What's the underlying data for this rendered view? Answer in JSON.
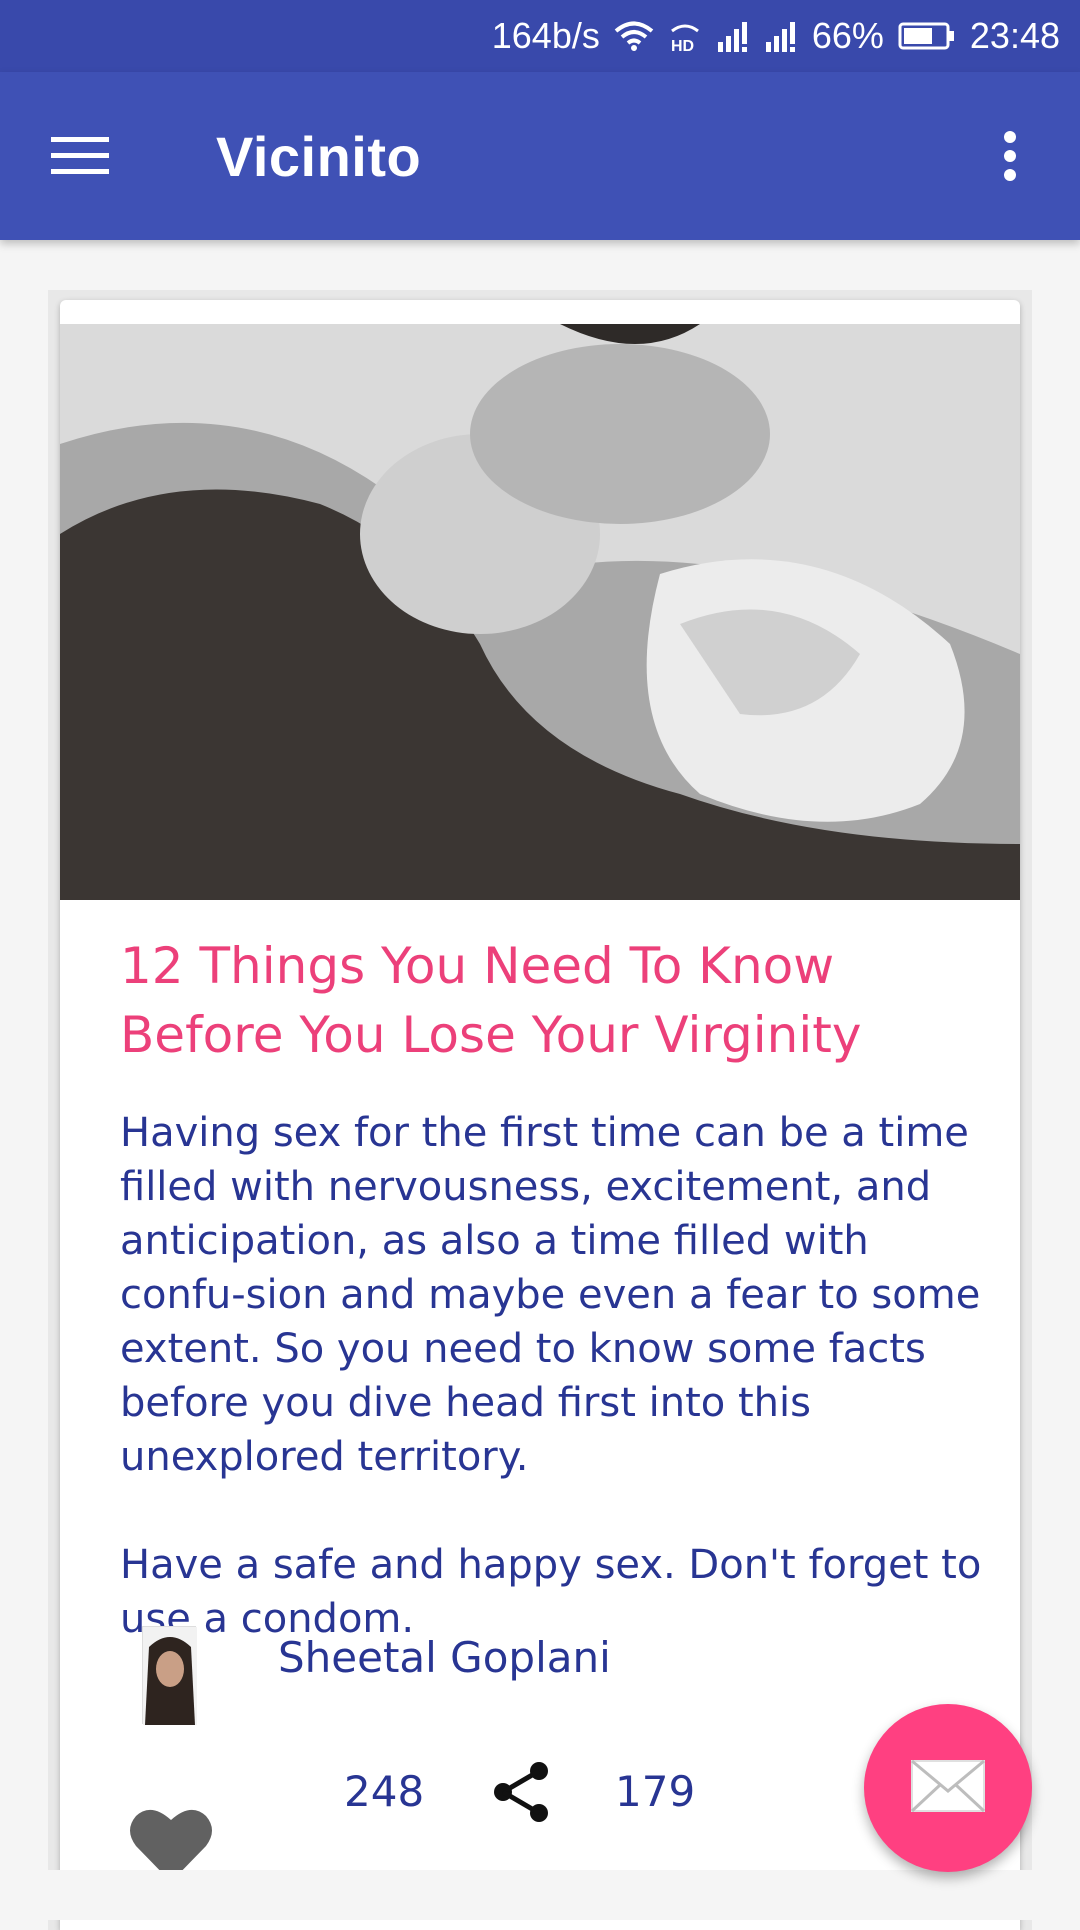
{
  "status_bar": {
    "network_speed": "164b/s",
    "battery_percent": "66%",
    "time": "23:48",
    "icons": [
      "wifi-icon",
      "hd-icon",
      "signal-icon",
      "signal-icon",
      "battery-icon"
    ]
  },
  "app_bar": {
    "title": "Vicinito",
    "menu_icon": "hamburger-menu-icon",
    "overflow_icon": "more-vert-icon"
  },
  "post": {
    "title": "12 Things You Need To Know Before You Lose Your Virginity",
    "body_paragraphs": [
      "Having sex for the first time can be a time filled with nervousness, excitement, and anticipation, as also a time filled with confu-sion and maybe even a fear to some extent. So you need to know some facts before you dive head first into this unexplored territory.",
      "Have a safe and happy sex. Don't forget to use a condom."
    ],
    "author": "Sheetal Goplani",
    "likes": "248",
    "shares": "179"
  },
  "colors": {
    "primary": "#3f51b5",
    "primary_dark": "#3949ab",
    "accent": "#ff4081",
    "title_pink": "#ec407a",
    "body_indigo": "#283593"
  },
  "fab": {
    "icon": "mail-icon"
  }
}
